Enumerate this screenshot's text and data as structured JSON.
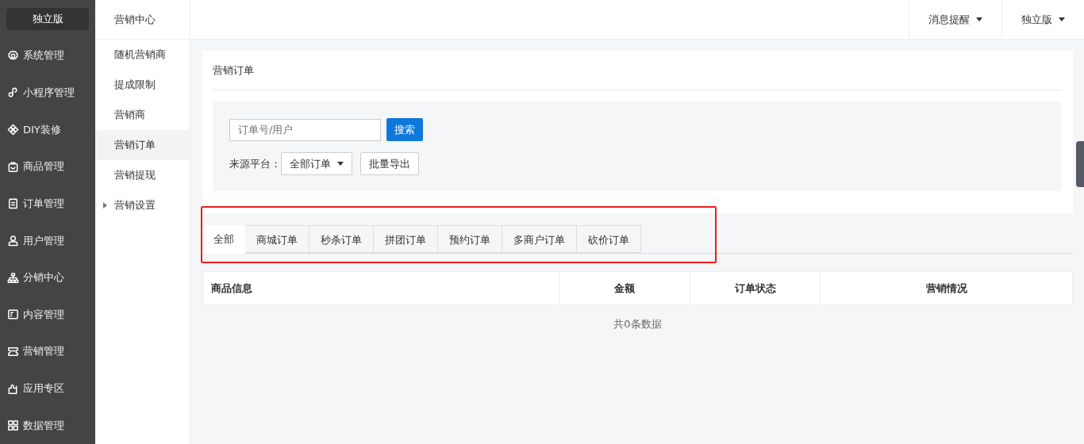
{
  "sidebar": {
    "brand": "独立版",
    "items": [
      {
        "label": "系统管理"
      },
      {
        "label": "小程序管理"
      },
      {
        "label": "DIY装修"
      },
      {
        "label": "商品管理"
      },
      {
        "label": "订单管理"
      },
      {
        "label": "用户管理"
      },
      {
        "label": "分销中心"
      },
      {
        "label": "内容管理"
      },
      {
        "label": "营销管理"
      },
      {
        "label": "应用专区"
      },
      {
        "label": "数据管理"
      }
    ]
  },
  "submenu": {
    "title": "营销中心",
    "items": [
      {
        "label": "随机营销商",
        "selected": false,
        "expandable": false
      },
      {
        "label": "提成限制",
        "selected": false,
        "expandable": false
      },
      {
        "label": "营销商",
        "selected": false,
        "expandable": false
      },
      {
        "label": "营销订单",
        "selected": true,
        "expandable": false
      },
      {
        "label": "营销提现",
        "selected": false,
        "expandable": false
      },
      {
        "label": "营销设置",
        "selected": false,
        "expandable": true
      }
    ]
  },
  "topbar": {
    "menus": [
      "消息提醒",
      "独立版"
    ]
  },
  "card": {
    "title": "营销订单",
    "search": {
      "placeholder": "订单号/用户",
      "button": "搜索"
    },
    "source_label": "来源平台：",
    "source_value": "全部订单",
    "export_button": "批量导出"
  },
  "tabs": [
    {
      "label": "全部",
      "selected": true
    },
    {
      "label": "商城订单",
      "selected": false
    },
    {
      "label": "秒杀订单",
      "selected": false
    },
    {
      "label": "拼团订单",
      "selected": false
    },
    {
      "label": "预约订单",
      "selected": false
    },
    {
      "label": "多商户订单",
      "selected": false
    },
    {
      "label": "砍价订单",
      "selected": false
    }
  ],
  "table": {
    "columns": [
      "商品信息",
      "金额",
      "订单状态",
      "营销情况"
    ],
    "empty": "共0条数据"
  }
}
